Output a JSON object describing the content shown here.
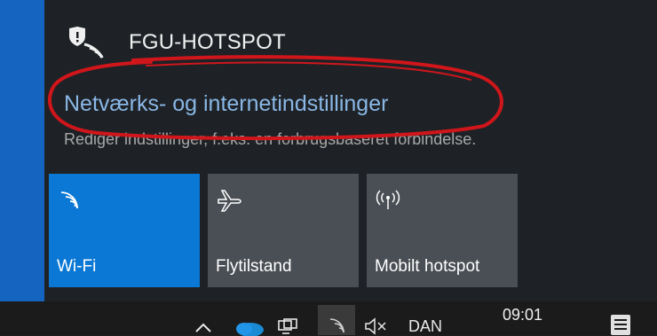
{
  "network": {
    "ssid": "FGU-HOTSPOT"
  },
  "settings": {
    "link_label": "Netværks- og internetindstillinger",
    "subtitle": "Rediger indstillinger, f.eks. en forbrugsbaseret forbindelse."
  },
  "tiles": [
    {
      "label": "Wi-Fi",
      "icon": "wifi-icon",
      "active": true
    },
    {
      "label": "Flytilstand",
      "icon": "airplane-icon",
      "active": false
    },
    {
      "label": "Mobilt hotspot",
      "icon": "hotspot-icon",
      "active": false
    }
  ],
  "taskbar": {
    "language": "DAN",
    "time": "09:01",
    "icons": [
      "chevron-up-icon",
      "onedrive-icon",
      "network-status-icon",
      "wifi-icon",
      "volume-muted-icon",
      "action-center-icon"
    ]
  },
  "colors": {
    "accent": "#0a78d4",
    "link": "#8ab7e6",
    "annotation": "#d0161b"
  }
}
